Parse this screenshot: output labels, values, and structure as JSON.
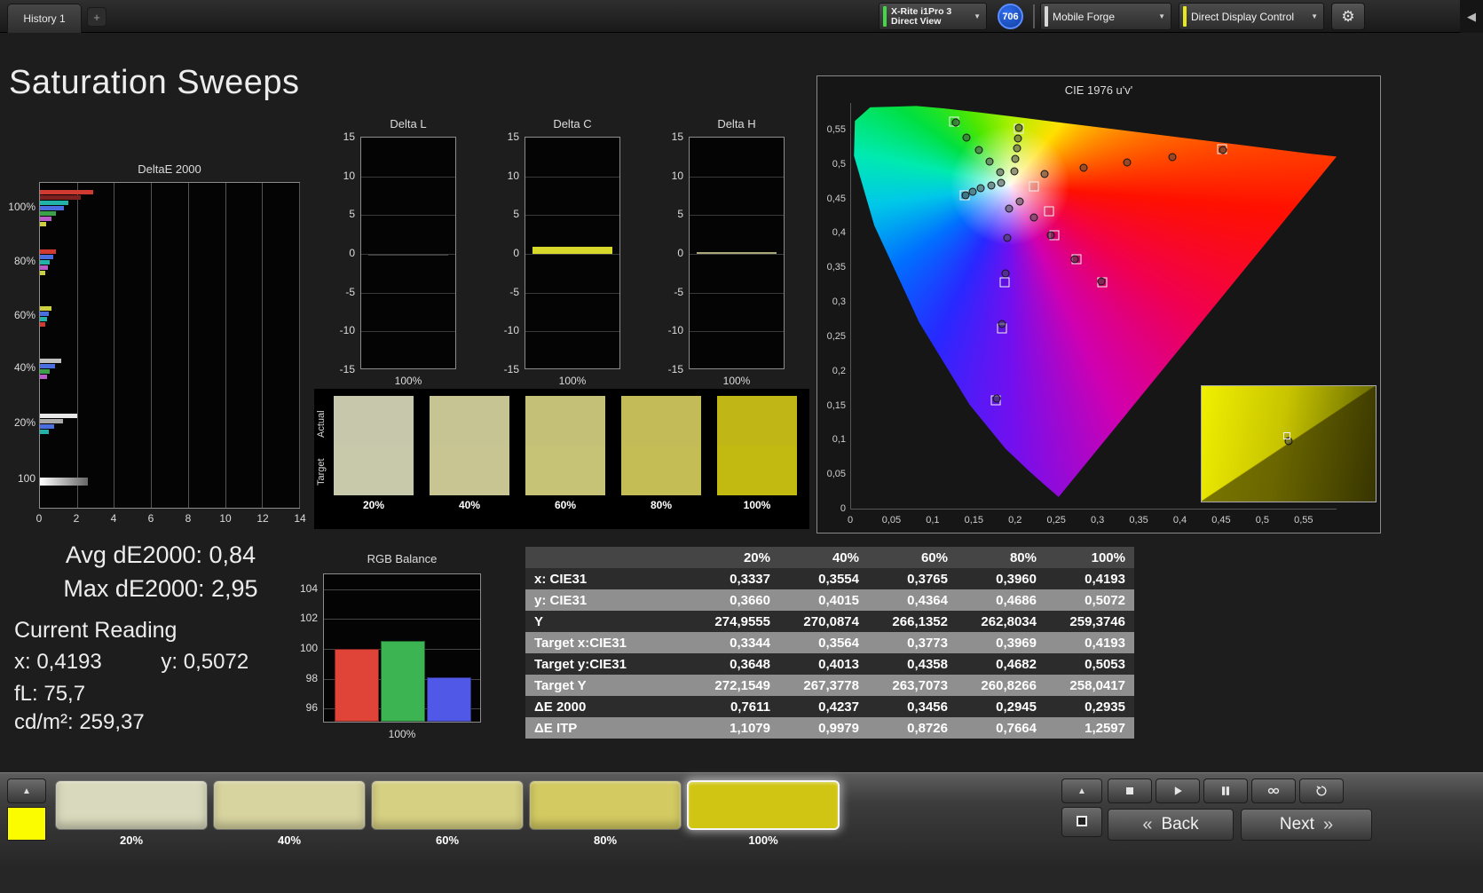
{
  "colors": {
    "background": "#1d1d1d",
    "accent_yellow": "#fcfc00",
    "meter_status_green": "#44d844",
    "source_status_gray": "#d8d8d8",
    "display_status_yellow": "#e8e81a",
    "badge_blue": "#1b57d6"
  },
  "topbar": {
    "tab_label": "History 1",
    "add_tab_label": "+",
    "meter": {
      "line1": "X-Rite i1Pro 3",
      "line2": "Direct View",
      "status_color": "#44d844"
    },
    "badge": {
      "text": "706",
      "color": "#1b57d6"
    },
    "source": {
      "label": "Mobile Forge",
      "status_color": "#d8d8d8"
    },
    "display_control": {
      "label": "Direct Display Control",
      "status_color": "#e8e81a"
    },
    "caret_glyph": "▼",
    "settings_glyph": "⚙",
    "collapse_glyph": "◀"
  },
  "page_title": "Saturation Sweeps",
  "stats": {
    "avg": "Avg dE2000: 0,84",
    "max": "Max dE2000: 2,95",
    "current_reading_label": "Current Reading",
    "x": "x: 0,4193",
    "y": "y: 0,5072",
    "fl": "fL: 75,7",
    "cdm2": "cd/m²: 259,37"
  },
  "chart_data": [
    {
      "id": "deltae2000",
      "type": "bar",
      "orientation": "horizontal",
      "title": "DeltaE 2000",
      "xlim": [
        0,
        14
      ],
      "xticks": [
        0,
        2,
        4,
        6,
        8,
        10,
        12,
        14
      ],
      "groups": [
        {
          "label": "100%",
          "bars": [
            {
              "color": "#d03a30",
              "value": 2.9
            },
            {
              "color": "#7c2020",
              "value": 2.2
            },
            {
              "color": "#22b2a8",
              "value": 1.55
            },
            {
              "color": "#4a6ee0",
              "value": 1.3
            },
            {
              "color": "#3aa04a",
              "value": 0.85
            },
            {
              "color": "#b85ac8",
              "value": 0.6
            },
            {
              "color": "#cccf40",
              "value": 0.35
            }
          ]
        },
        {
          "label": "80%",
          "bars": [
            {
              "color": "#d03a30",
              "value": 0.85
            },
            {
              "color": "#4a6ee0",
              "value": 0.7
            },
            {
              "color": "#22b2a8",
              "value": 0.55
            },
            {
              "color": "#b85ac8",
              "value": 0.45
            },
            {
              "color": "#cccf40",
              "value": 0.3
            }
          ]
        },
        {
          "label": "60%",
          "bars": [
            {
              "color": "#cccf40",
              "value": 0.6
            },
            {
              "color": "#4a6ee0",
              "value": 0.5
            },
            {
              "color": "#22b2a8",
              "value": 0.4
            },
            {
              "color": "#d03a30",
              "value": 0.3
            }
          ]
        },
        {
          "label": "40%",
          "bars": [
            {
              "color": "#c0c0c0",
              "value": 1.15
            },
            {
              "color": "#4a6ee0",
              "value": 0.8
            },
            {
              "color": "#3aa04a",
              "value": 0.55
            },
            {
              "color": "#b85ac8",
              "value": 0.4
            }
          ]
        },
        {
          "label": "20%",
          "bars": [
            {
              "color": "#e8e8e8",
              "value": 2.0
            },
            {
              "color": "#a8a8a8",
              "value": 1.25
            },
            {
              "color": "#4a6ee0",
              "value": 0.75
            },
            {
              "color": "#22b2a8",
              "value": 0.5
            }
          ]
        },
        {
          "label": "100",
          "bars": [
            {
              "color": "grayscale-gradient",
              "value": 2.6
            }
          ]
        }
      ]
    },
    {
      "id": "delta_l",
      "type": "bar",
      "title": "Delta L",
      "ylim": [
        -15,
        15
      ],
      "yticks": [
        15,
        10,
        5,
        0,
        -5,
        -10,
        -15
      ],
      "categories": [
        "100%"
      ],
      "values": [
        -0.2
      ],
      "bar_color": "#404040"
    },
    {
      "id": "delta_c",
      "type": "bar",
      "title": "Delta C",
      "ylim": [
        -15,
        15
      ],
      "yticks": [
        15,
        10,
        5,
        0,
        -5,
        -10,
        -15
      ],
      "categories": [
        "100%"
      ],
      "values": [
        0.9
      ],
      "bar_color": "#d8d82a"
    },
    {
      "id": "delta_h",
      "type": "bar",
      "title": "Delta H",
      "ylim": [
        -15,
        15
      ],
      "yticks": [
        15,
        10,
        5,
        0,
        -5,
        -10,
        -15
      ],
      "categories": [
        "100%"
      ],
      "values": [
        0.25
      ],
      "bar_color": "#a8a878"
    },
    {
      "id": "rgb_balance",
      "type": "bar",
      "title": "RGB Balance",
      "ylim": [
        95,
        105
      ],
      "yticks": [
        104,
        102,
        100,
        98,
        96
      ],
      "categories": [
        "100%"
      ],
      "series": [
        {
          "name": "Red",
          "color": "#e04438",
          "values": [
            99.9
          ]
        },
        {
          "name": "Green",
          "color": "#3cb452",
          "values": [
            100.4
          ]
        },
        {
          "name": "Blue",
          "color": "#5058e8",
          "values": [
            98.0
          ]
        }
      ]
    },
    {
      "id": "cie",
      "type": "scatter",
      "title": "CIE 1976 u'v'",
      "xlim": [
        0,
        0.59
      ],
      "ylim": [
        0,
        0.59
      ],
      "xticks": [
        "0",
        "0,05",
        "0,1",
        "0,15",
        "0,2",
        "0,25",
        "0,3",
        "0,35",
        "0,4",
        "0,45",
        "0,5",
        "0,55"
      ],
      "yticks": [
        "0",
        "0,05",
        "0,1",
        "0,15",
        "0,2",
        "0,25",
        "0,3",
        "0,35",
        "0,4",
        "0,45",
        "0,5",
        "0,55"
      ],
      "white_point": [
        0.193,
        0.47
      ],
      "target_squares": [
        [
          0.125,
          0.5625
        ],
        [
          0.204,
          0.553
        ],
        [
          0.4507,
          0.5229
        ],
        [
          0.1385,
          0.4557
        ],
        [
          0.3053,
          0.3295
        ],
        [
          0.1754,
          0.1579
        ],
        [
          0.24,
          0.432
        ],
        [
          0.247,
          0.397
        ],
        [
          0.274,
          0.363
        ],
        [
          0.187,
          0.329
        ],
        [
          0.183,
          0.262
        ],
        [
          0.222,
          0.468
        ]
      ],
      "measured_circles": [
        [
          0.1985,
          0.49
        ],
        [
          0.2,
          0.5084
        ],
        [
          0.2012,
          0.5248
        ],
        [
          0.2023,
          0.5385
        ],
        [
          0.2034,
          0.5535
        ],
        [
          0.235,
          0.487
        ],
        [
          0.283,
          0.496
        ],
        [
          0.335,
          0.504
        ],
        [
          0.39,
          0.511
        ],
        [
          0.452,
          0.521
        ],
        [
          0.181,
          0.489
        ],
        [
          0.168,
          0.505
        ],
        [
          0.155,
          0.522
        ],
        [
          0.14,
          0.54
        ],
        [
          0.127,
          0.561
        ],
        [
          0.182,
          0.474
        ],
        [
          0.17,
          0.47
        ],
        [
          0.158,
          0.466
        ],
        [
          0.148,
          0.461
        ],
        [
          0.139,
          0.456
        ],
        [
          0.192,
          0.437
        ],
        [
          0.19,
          0.394
        ],
        [
          0.188,
          0.342
        ],
        [
          0.183,
          0.268
        ],
        [
          0.177,
          0.16
        ],
        [
          0.205,
          0.447
        ],
        [
          0.222,
          0.424
        ],
        [
          0.243,
          0.398
        ],
        [
          0.272,
          0.363
        ],
        [
          0.304,
          0.33
        ]
      ],
      "inset": {
        "circle": [
          0.5,
          0.48
        ],
        "square": [
          0.49,
          0.43
        ]
      }
    },
    {
      "id": "results_table",
      "type": "table",
      "columns": [
        "",
        "20%",
        "40%",
        "60%",
        "80%",
        "100%"
      ],
      "rows": [
        [
          "x: CIE31",
          "0,3337",
          "0,3554",
          "0,3765",
          "0,3960",
          "0,4193"
        ],
        [
          "y: CIE31",
          "0,3660",
          "0,4015",
          "0,4364",
          "0,4686",
          "0,5072"
        ],
        [
          "Y",
          "274,9555",
          "270,0874",
          "266,1352",
          "262,8034",
          "259,3746"
        ],
        [
          "Target x:CIE31",
          "0,3344",
          "0,3564",
          "0,3773",
          "0,3969",
          "0,4193"
        ],
        [
          "Target y:CIE31",
          "0,3648",
          "0,4013",
          "0,4358",
          "0,4682",
          "0,5053"
        ],
        [
          "Target Y",
          "272,1549",
          "267,3778",
          "263,7073",
          "260,8266",
          "258,0417"
        ],
        [
          "ΔE 2000",
          "0,7611",
          "0,4237",
          "0,3456",
          "0,2945",
          "0,2935"
        ],
        [
          "ΔE ITP",
          "1,1079",
          "0,9979",
          "0,8726",
          "0,7664",
          "1,2597"
        ]
      ]
    }
  ],
  "swatch_strip": {
    "row_labels": [
      "Actual",
      "Target"
    ],
    "swatches": [
      {
        "label": "20%",
        "actual": "#c7c7ac",
        "target": "#c8c8aa"
      },
      {
        "label": "40%",
        "actual": "#c7c494",
        "target": "#c8c592"
      },
      {
        "label": "60%",
        "actual": "#c5c078",
        "target": "#c6c276"
      },
      {
        "label": "80%",
        "actual": "#c2bb58",
        "target": "#c4bd55"
      },
      {
        "label": "100%",
        "actual": "#c0b716",
        "target": "#c2ba10"
      }
    ]
  },
  "bottom_bar": {
    "reference_swatch_color": "#fcfc00",
    "up_glyph": "▲",
    "patches": [
      {
        "label": "20%",
        "color": "#d9d9bd",
        "selected": false
      },
      {
        "label": "40%",
        "color": "#d8d4a0",
        "selected": false
      },
      {
        "label": "60%",
        "color": "#d6d083",
        "selected": false
      },
      {
        "label": "80%",
        "color": "#d3ca62",
        "selected": false
      },
      {
        "label": "100%",
        "color": "#d0c512",
        "selected": true
      }
    ],
    "transport": [
      {
        "name": "stop"
      },
      {
        "name": "play"
      },
      {
        "name": "pause"
      },
      {
        "name": "loop"
      },
      {
        "name": "refresh"
      }
    ],
    "back_chevron": "«",
    "back_label": "Back",
    "next_label": "Next",
    "next_chevron": "»"
  }
}
